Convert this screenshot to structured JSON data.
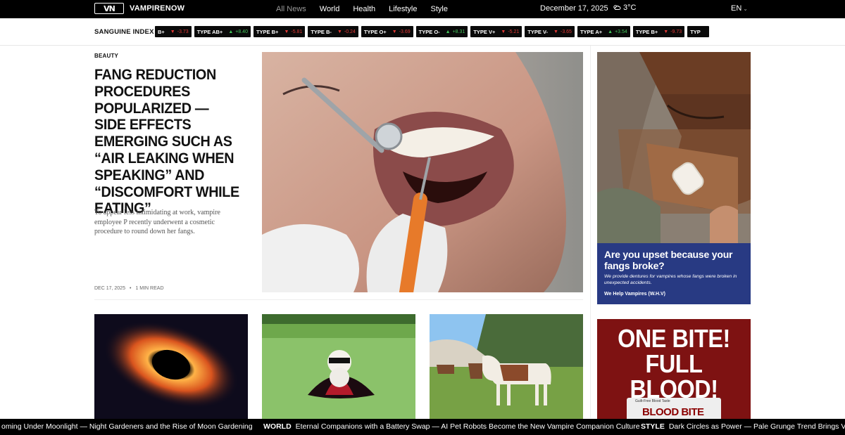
{
  "brand": {
    "logo_mark": "VN",
    "name": "VAMPIRENOW"
  },
  "nav": {
    "links": [
      {
        "label": "All News",
        "active": true
      },
      {
        "label": "World",
        "active": false
      },
      {
        "label": "Health",
        "active": false
      },
      {
        "label": "Lifestyle",
        "active": false
      },
      {
        "label": "Style",
        "active": false
      }
    ],
    "date": "December 17, 2025",
    "weather": {
      "icon": "cloud-sun-icon",
      "temp": "3°C"
    },
    "language": "EN"
  },
  "ticker": {
    "title": "SANGUINE INDEX",
    "items": [
      {
        "label": "B+",
        "direction": "down",
        "value": "-3.73"
      },
      {
        "label": "TYPE AB+",
        "direction": "up",
        "value": "+8.40"
      },
      {
        "label": "TYPE B+",
        "direction": "down",
        "value": "-5.81"
      },
      {
        "label": "TYPE B-",
        "direction": "down",
        "value": "-0.24"
      },
      {
        "label": "TYPE O+",
        "direction": "down",
        "value": "-3.69"
      },
      {
        "label": "TYPE O-",
        "direction": "up",
        "value": "+8.31"
      },
      {
        "label": "TYPE V+",
        "direction": "down",
        "value": "-5.21"
      },
      {
        "label": "TYPE V-",
        "direction": "down",
        "value": "-3.65"
      },
      {
        "label": "TYPE A+",
        "direction": "up",
        "value": "+3.54"
      },
      {
        "label": "TYPE B+",
        "direction": "down",
        "value": "-9.73"
      },
      {
        "label": "TYP",
        "direction": "",
        "value": ""
      }
    ]
  },
  "hero": {
    "kicker": "BEAUTY",
    "headline": "FANG REDUCTION PROCEDURES POPULARIZED — SIDE EFFECTS EMERGING SUCH AS “AIR LEAKING WHEN SPEAKING” AND “DISCOMFORT WHILE EATING”",
    "dek": "To appear less intimidating at work, vampire employee P recently underwent a cosmetic procedure to round down her fangs.",
    "date": "DEC 17, 2025",
    "read_time": "1 MIN READ"
  },
  "ads": {
    "dentures": {
      "headline": "Are you upset because your fangs broke?",
      "body": "We provide dentures for vampires whose fangs were broken in unexpected accidents.",
      "sponsor": "We Help Vampires (W.H.V)"
    },
    "bloodbite": {
      "headline_1": "ONE BITE!",
      "headline_2": "FULL BLOOD!",
      "package_tag": "Guilt-Free Blood Taste",
      "package_brand": "BLOOD BITE"
    }
  },
  "crawl": [
    {
      "section": "",
      "text": "oming Under Moonlight — Night Gardeners and the Rise of Moon Gardening"
    },
    {
      "section": "WORLD",
      "text": "Eternal Companions with a Battery Swap — AI Pet Robots Become the New Vampire Companion Culture"
    },
    {
      "section": "STYLE",
      "text": "Dark Circles as Power — Pale Grunge Trend Brings Van"
    }
  ]
}
